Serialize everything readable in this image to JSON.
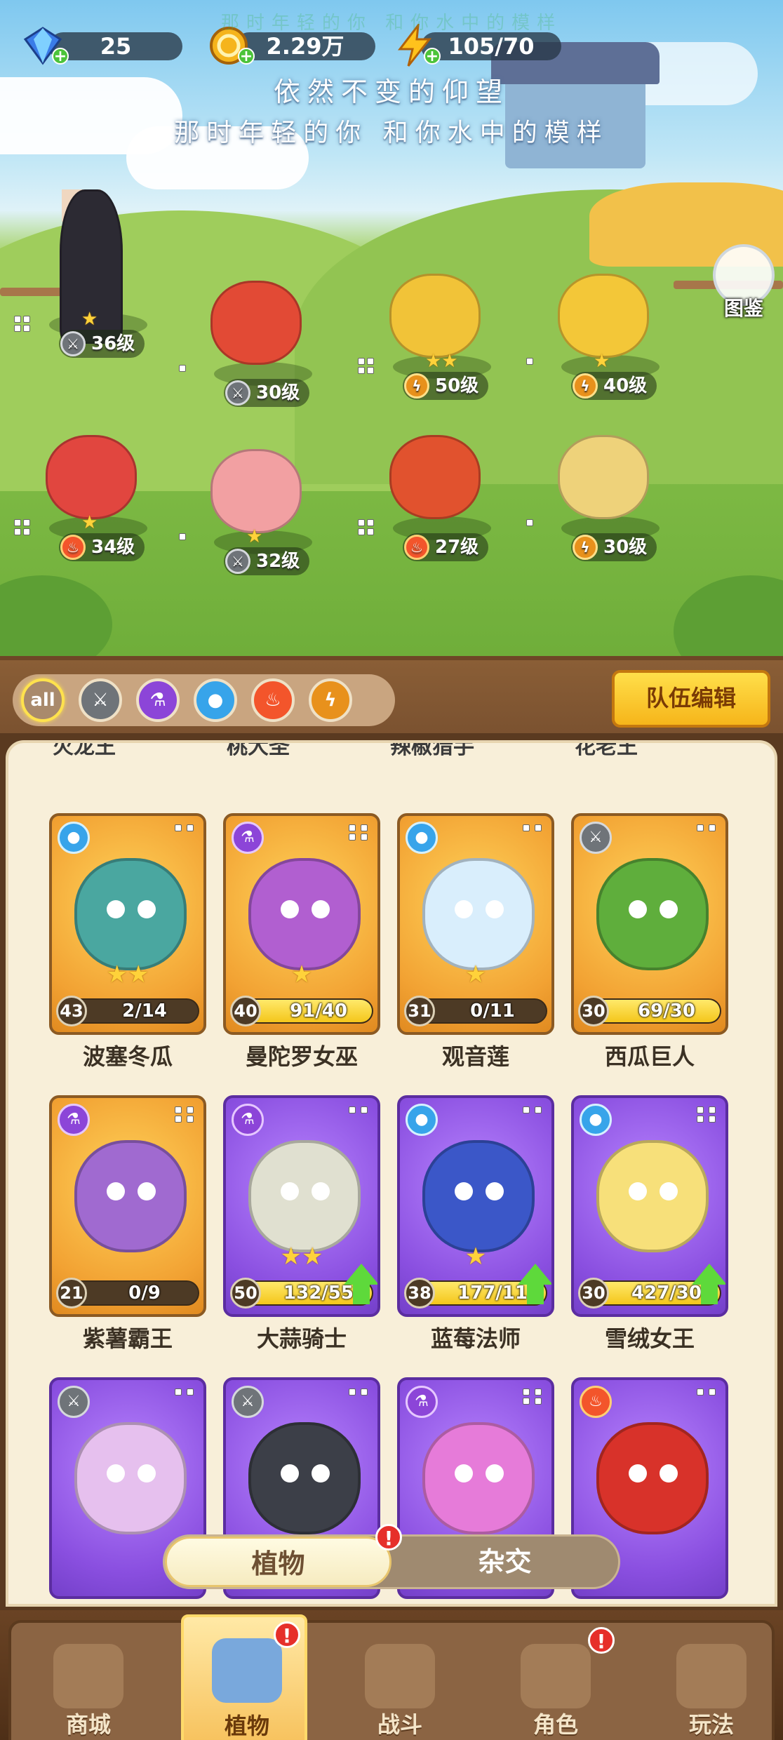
{
  "resources": {
    "gems": "25",
    "coins": "2.29万",
    "energy": "105/70"
  },
  "lyrics": {
    "faded_line": "那时年轻的你 和你水中的模样",
    "line1": "依然不变的仰望",
    "line2": "那时年轻的你 和你水中的模样"
  },
  "codex_label": "图鉴",
  "field_heroes": [
    {
      "level": "36级",
      "element": "sword",
      "stars": "★",
      "icon": "bat-hero-icon"
    },
    {
      "level": "30级",
      "element": "sword",
      "stars": "",
      "icon": "tomato-hero-icon"
    },
    {
      "level": "50级",
      "element": "bolt",
      "stars": "★★",
      "icon": "iron-hero-icon"
    },
    {
      "level": "40级",
      "element": "bolt",
      "stars": "★",
      "icon": "golden-king-icon"
    },
    {
      "level": "34级",
      "element": "fire",
      "stars": "★",
      "icon": "dragon-king-icon"
    },
    {
      "level": "32级",
      "element": "sword",
      "stars": "★",
      "icon": "peach-hero-icon"
    },
    {
      "level": "27级",
      "element": "fire",
      "stars": "",
      "icon": "chili-girl-icon"
    },
    {
      "level": "30级",
      "element": "bolt",
      "stars": "",
      "icon": "walnut-hero-icon"
    }
  ],
  "filters": [
    "all",
    "sword",
    "poison",
    "water",
    "fire",
    "bolt"
  ],
  "team_edit_label": "队伍编辑",
  "cut_names": [
    "火龙王",
    "桃大圣",
    "辣椒猎手",
    "花老王"
  ],
  "cards": [
    {
      "name": "波塞冬瓜",
      "level": "43",
      "progress": "2/14",
      "fill": 0.14,
      "element": "water",
      "stars": "★★",
      "color": "gold",
      "upgrade": false,
      "face": "#4aa7a0"
    },
    {
      "name": "曼陀罗女巫",
      "level": "40",
      "progress": "91/40",
      "fill": 1.0,
      "element": "poison",
      "stars": "★",
      "color": "gold",
      "upgrade": false,
      "face": "#b15fd0"
    },
    {
      "name": "观音莲",
      "level": "31",
      "progress": "0/11",
      "fill": 0.0,
      "element": "water",
      "stars": "★",
      "color": "gold",
      "upgrade": false,
      "face": "#d9eefc"
    },
    {
      "name": "西瓜巨人",
      "level": "30",
      "progress": "69/30",
      "fill": 1.0,
      "element": "sword",
      "stars": "",
      "color": "gold",
      "upgrade": false,
      "face": "#5fae3c"
    },
    {
      "name": "紫薯霸王",
      "level": "21",
      "progress": "0/9",
      "fill": 0.0,
      "element": "poison",
      "stars": "",
      "color": "gold",
      "upgrade": false,
      "face": "#a06ad0"
    },
    {
      "name": "大蒜骑士",
      "level": "50",
      "progress": "132/55",
      "fill": 1.0,
      "element": "poison",
      "stars": "★★",
      "color": "purple",
      "upgrade": true,
      "face": "#e0e0d0"
    },
    {
      "name": "蓝莓法师",
      "level": "38",
      "progress": "177/11",
      "fill": 1.0,
      "element": "water",
      "stars": "★",
      "color": "purple",
      "upgrade": true,
      "face": "#3b57c8"
    },
    {
      "name": "雪绒女王",
      "level": "30",
      "progress": "427/30",
      "fill": 1.0,
      "element": "water",
      "stars": "",
      "color": "purple",
      "upgrade": true,
      "face": "#f7e07a"
    },
    {
      "name": "",
      "level": "",
      "progress": "",
      "fill": 0,
      "element": "sword",
      "stars": "",
      "color": "purple",
      "upgrade": false,
      "face": "#e6c0ee"
    },
    {
      "name": "",
      "level": "",
      "progress": "",
      "fill": 0,
      "element": "sword",
      "stars": "",
      "color": "purple",
      "upgrade": false,
      "face": "#3c3f48"
    },
    {
      "name": "",
      "level": "",
      "progress": "",
      "fill": 0,
      "element": "poison",
      "stars": "",
      "color": "purple",
      "upgrade": false,
      "face": "#e67bd9"
    },
    {
      "name": "",
      "level": "",
      "progress": "",
      "fill": 0,
      "element": "fire",
      "stars": "",
      "color": "purple",
      "upgrade": false,
      "face": "#d8322a"
    }
  ],
  "toggle": {
    "plants": "植物",
    "hybrid": "杂交",
    "plants_badge": "!"
  },
  "nav": [
    {
      "label": "商城",
      "icon": "shop-icon",
      "badge": ""
    },
    {
      "label": "植物",
      "icon": "plants-icon",
      "badge": "!"
    },
    {
      "label": "战斗",
      "icon": "battle-icon",
      "badge": ""
    },
    {
      "label": "角色",
      "icon": "character-icon",
      "badge": "!"
    },
    {
      "label": "玩法",
      "icon": "gameplay-icon",
      "badge": ""
    }
  ],
  "element_glyphs": {
    "sword": "⚔",
    "bolt": "ϟ",
    "fire": "♨",
    "water": "●",
    "poison": "⚗",
    "all": "all"
  }
}
